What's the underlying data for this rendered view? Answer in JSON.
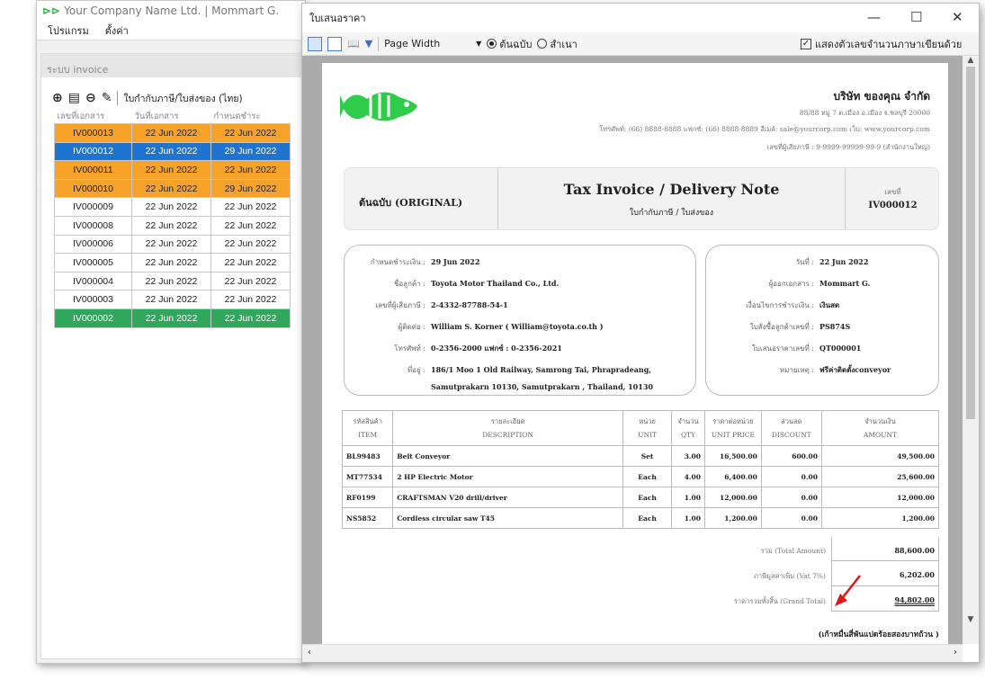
{
  "main_window": {
    "title": "Your Company Name Ltd. | Mommart G.",
    "menu": [
      "โปรแกรม",
      "ตั้งค่า"
    ],
    "panel_title": "ระบบ invoice",
    "toolbar": {
      "add_icon": "plus-circle-icon",
      "doc_icon": "document-icon",
      "remove_icon": "minus-circle-icon",
      "edit_icon": "pencil-icon",
      "label": "ใบกำกับภาษี/ใบส่งของ (ไทย)"
    },
    "columns": [
      "เลขที่เอกสาร",
      "วันที่เอกสาร",
      "กำหนดชำระ"
    ],
    "rows": [
      {
        "doc": "IV000013",
        "date": "22 Jun 2022",
        "due": "22 Jun 2022",
        "status": "orange"
      },
      {
        "doc": "IV000012",
        "date": "22 Jun 2022",
        "due": "29 Jun 2022",
        "status": "blue"
      },
      {
        "doc": "IV000011",
        "date": "22 Jun 2022",
        "due": "22 Jun 2022",
        "status": "orange"
      },
      {
        "doc": "IV000010",
        "date": "22 Jun 2022",
        "due": "29 Jun 2022",
        "status": "orange"
      },
      {
        "doc": "IV000009",
        "date": "22 Jun 2022",
        "due": "22 Jun 2022",
        "status": "none"
      },
      {
        "doc": "IV000008",
        "date": "22 Jun 2022",
        "due": "22 Jun 2022",
        "status": "none"
      },
      {
        "doc": "IV000006",
        "date": "22 Jun 2022",
        "due": "22 Jun 2022",
        "status": "none"
      },
      {
        "doc": "IV000005",
        "date": "22 Jun 2022",
        "due": "22 Jun 2022",
        "status": "none"
      },
      {
        "doc": "IV000004",
        "date": "22 Jun 2022",
        "due": "22 Jun 2022",
        "status": "none"
      },
      {
        "doc": "IV000003",
        "date": "22 Jun 2022",
        "due": "22 Jun 2022",
        "status": "none"
      },
      {
        "doc": "IV000002",
        "date": "22 Jun 2022",
        "due": "22 Jun 2022",
        "status": "green"
      }
    ]
  },
  "preview_window": {
    "title": "ใบเสนอราคา",
    "window_controls": {
      "minimize": "—",
      "maximize": "☐",
      "close": "✕"
    },
    "toolbar": {
      "zoom_value": "Page Width",
      "radio_original": "ต้นฉบับ",
      "radio_copy": "สำเนา",
      "checkbox_label": "แสดงตัวเลขจำนวนภาษาเขียนด้วย",
      "checkbox_checked": true
    },
    "document": {
      "company_name": "บริษัท ของคุณ จำกัด",
      "company_address": "88/88 หมู่ 7 ต.เมือง อ.เมือง จ.ชลบุรี 20000",
      "company_contact": "โทรศัพท์: (66) 8888-8888  แฟกซ์: (66) 8888-8889  อีเมล์: sale@yourcorp.com  เว็บ: www.yourcorp.com",
      "company_tax": "เลขที่ผู้เสียภาษี : 9-9999-99999-99-9 (สำนักงานใหญ่)",
      "copy_label": "ต้นฉบับ (ORIGINAL)",
      "doc_title": "Tax Invoice / Delivery Note",
      "doc_subtitle": "ใบกำกับภาษี / ใบส่งของ",
      "doc_no_label": "เลขที่",
      "doc_no": "IV000012",
      "left_info": [
        {
          "k": "กำหนดชำระเงิน :",
          "v": "29 Jun 2022"
        },
        {
          "k": "ชื่อลูกค้า :",
          "v": "Toyota Motor Thailand Co., Ltd."
        },
        {
          "k": "เลขที่ผู้เสียภาษี :",
          "v": "2-4332-87788-54-1"
        },
        {
          "k": "ผู้ติดต่อ :",
          "v": "William S. Korner ( William@toyota.co.th )"
        },
        {
          "k": "โทรศัพท์ :",
          "v": "0-2356-2000  แฟกซ์ : 0-2356-2021"
        },
        {
          "k": "ที่อยู่ :",
          "v": "186/1 Moo 1 Old Railway, Samrong Tai, Phrapradeang,"
        },
        {
          "k": "",
          "v": "Samutprakarn 10130, Samutprakarn , Thailand, 10130"
        }
      ],
      "right_info": [
        {
          "k": "วันที่ :",
          "v": "22 Jun 2022"
        },
        {
          "k": "ผู้ออกเอกสาร :",
          "v": "Mommart G."
        },
        {
          "k": "เงื่อนไขการชำระเงิน :",
          "v": "เงินสด"
        },
        {
          "k": "ใบสั่งซื้อลูกค้าเลขที่ :",
          "v": "PS874S"
        },
        {
          "k": "ใบเสนอราคาเลขที่ :",
          "v": "QT000001"
        },
        {
          "k": "หมายเหตุ :",
          "v": "ฟรีค่าติดตั้งconveyor"
        }
      ],
      "item_headers": [
        {
          "th": "รหัสสินค้า",
          "en": "ITEM"
        },
        {
          "th": "รายละเอียด",
          "en": "DESCRIPTION"
        },
        {
          "th": "หน่วย",
          "en": "UNIT"
        },
        {
          "th": "จำนวน",
          "en": "QTY"
        },
        {
          "th": "ราคาต่อหน่วย",
          "en": "UNIT PRICE"
        },
        {
          "th": "ส่วนลด",
          "en": "DISCOUNT"
        },
        {
          "th": "จำนวนเงิน",
          "en": "AMOUNT"
        }
      ],
      "items": [
        {
          "code": "BL99483",
          "desc": "Belt Conveyor",
          "unit": "Set",
          "qty": "3.00",
          "price": "16,500.00",
          "disc": "600.00",
          "amount": "49,500.00"
        },
        {
          "code": "MT77534",
          "desc": "2 HP Electric Motor",
          "unit": "Each",
          "qty": "4.00",
          "price": "6,400.00",
          "disc": "0.00",
          "amount": "25,600.00"
        },
        {
          "code": "RF0199",
          "desc": "CRAFTSMAN V20 drill/driver",
          "unit": "Each",
          "qty": "1.00",
          "price": "12,000.00",
          "disc": "0.00",
          "amount": "12,000.00"
        },
        {
          "code": "NS5852",
          "desc": "Cordless circular saw T45",
          "unit": "Each",
          "qty": "1.00",
          "price": "1,200.00",
          "disc": "0.00",
          "amount": "1,200.00"
        }
      ],
      "total_label": "รวม (Total Amount)",
      "total": "88,600.00",
      "vat_label": "ภาษีมูลค่าเพิ่ม (Vat 7%)",
      "vat": "6,202.00",
      "grand_label": "ราคารวมทั้งสิ้น (Grand Total)",
      "grand_total": "94,802.00",
      "amount_text": "(เก้าหมื่นสี่พันแปดร้อยสองบาทถ้วน )"
    }
  }
}
